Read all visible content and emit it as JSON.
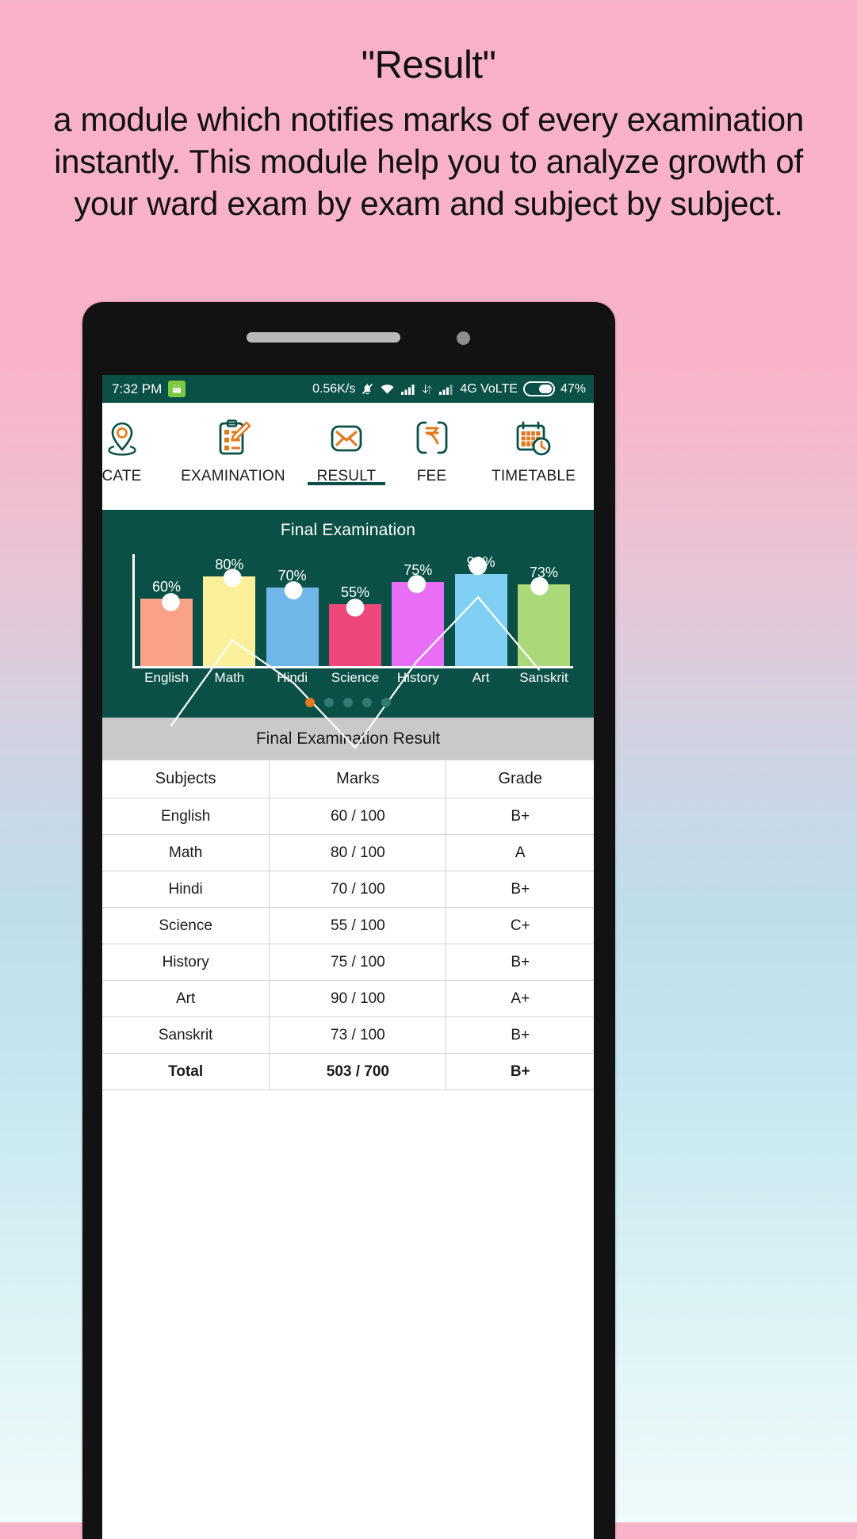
{
  "promo": {
    "title": "\"Result\"",
    "body": "a module which notifies marks of every examination instantly. This module help you to analyze growth of your ward exam by exam and subject by subject."
  },
  "status_bar": {
    "time": "7:32 PM",
    "data_speed": "0.56K/s",
    "network": "4G VoLTE",
    "battery": "47%",
    "icons": [
      "android-badge-icon",
      "mute-bell-icon",
      "wifi-icon",
      "signal-bars-icon",
      "data-transfer-icon",
      "signal-bars-icon",
      "battery-icon"
    ]
  },
  "tabs": [
    {
      "label": "CATE",
      "icon": "location-pin-icon",
      "active": false
    },
    {
      "label": "EXAMINATION",
      "icon": "clipboard-pencil-icon",
      "active": false
    },
    {
      "label": "RESULT",
      "icon": "envelope-icon",
      "active": true
    },
    {
      "label": "FEE",
      "icon": "rupee-icon",
      "active": false
    },
    {
      "label": "TIMETABLE",
      "icon": "calendar-clock-icon",
      "active": false
    }
  ],
  "carousel": {
    "total_dots": 5,
    "active_index": 0
  },
  "chart_data": {
    "type": "bar",
    "title": "Final Examination",
    "categories": [
      "English",
      "Math",
      "Hindi",
      "Science",
      "History",
      "Art",
      "Sanskrit"
    ],
    "values": [
      60,
      80,
      70,
      55,
      75,
      90,
      73
    ],
    "labels": [
      "60%",
      "80%",
      "70%",
      "55%",
      "75%",
      "90%",
      "73%"
    ],
    "bar_colors": [
      "#f9a287",
      "#fbf09a",
      "#6fb7e8",
      "#ee487b",
      "#e86ff5",
      "#7fd0f2",
      "#abd97a"
    ],
    "overlay_series": {
      "name": "trend",
      "type": "line",
      "values": [
        60,
        80,
        70,
        55,
        75,
        90,
        73
      ],
      "color": "#ffffff",
      "marker": "circle"
    },
    "xlabel": "",
    "ylabel": "",
    "ylim": [
      0,
      100
    ],
    "grid": false,
    "legend": "none",
    "background": "#0a5046"
  },
  "result_table": {
    "header": "Final Examination Result",
    "columns": [
      "Subjects",
      "Marks",
      "Grade"
    ],
    "rows": [
      {
        "subject": "English",
        "marks": "60 / 100",
        "grade": "B+"
      },
      {
        "subject": "Math",
        "marks": "80 / 100",
        "grade": "A"
      },
      {
        "subject": "Hindi",
        "marks": "70 / 100",
        "grade": "B+"
      },
      {
        "subject": "Science",
        "marks": "55 / 100",
        "grade": "C+"
      },
      {
        "subject": "History",
        "marks": "75 / 100",
        "grade": "B+"
      },
      {
        "subject": "Art",
        "marks": "90 / 100",
        "grade": "A+"
      },
      {
        "subject": "Sanskrit",
        "marks": "73 / 100",
        "grade": "B+"
      }
    ],
    "total": {
      "subject": "Total",
      "marks": "503 / 700",
      "grade": "B+"
    }
  },
  "colors": {
    "brand_teal": "#0a5046",
    "accent_orange": "#e07b1e",
    "header_grey": "#c9c9c9",
    "page_bg_top": "#f9b2c8",
    "page_bg_bottom": "#eefafb"
  }
}
